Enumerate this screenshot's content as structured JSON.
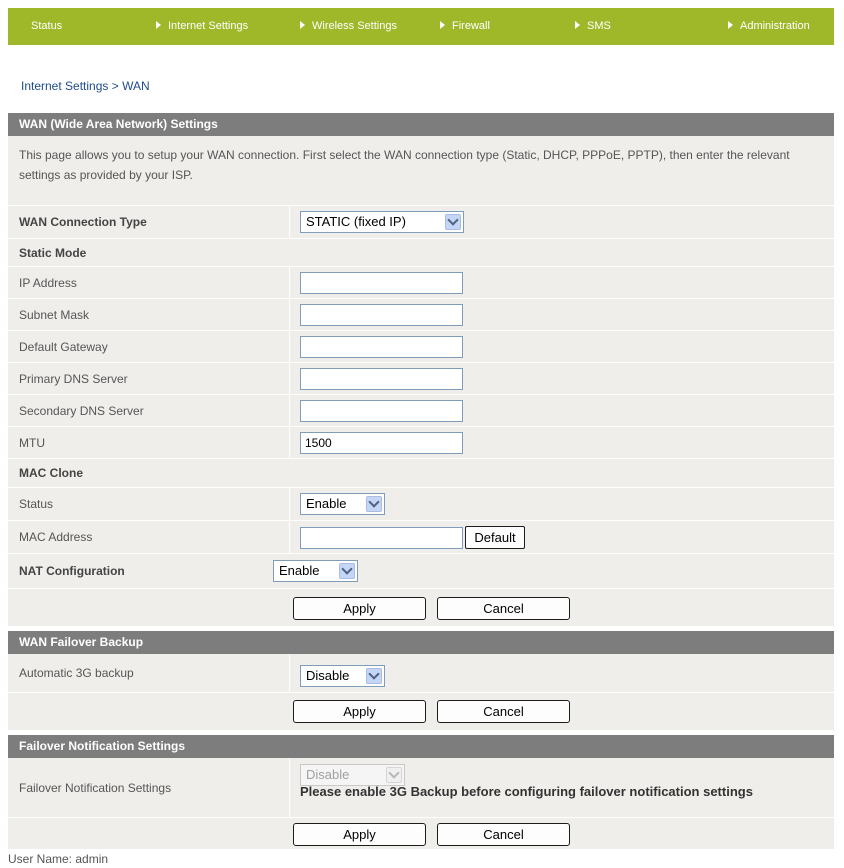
{
  "nav": {
    "items": [
      {
        "label": "Status",
        "arrow": false
      },
      {
        "label": "Internet Settings",
        "arrow": true
      },
      {
        "label": "Wireless Settings",
        "arrow": true
      },
      {
        "label": "Firewall",
        "arrow": true
      },
      {
        "label": "SMS",
        "arrow": true
      },
      {
        "label": "Administration",
        "arrow": true
      }
    ]
  },
  "breadcrumb": "Internet Settings > WAN",
  "wan": {
    "header": "WAN (Wide Area Network) Settings",
    "description": "This page allows you to setup your WAN connection. First select the WAN connection type (Static, DHCP, PPPoE, PPTP), then enter the relevant settings as provided by your ISP.",
    "connection_type_label": "WAN Connection Type",
    "connection_type_value": "STATIC (fixed IP)",
    "static_mode_label": "Static Mode",
    "ip_label": "IP Address",
    "ip_value": "",
    "subnet_label": "Subnet Mask",
    "subnet_value": "",
    "gateway_label": "Default Gateway",
    "gateway_value": "",
    "dns1_label": "Primary DNS Server",
    "dns1_value": "",
    "dns2_label": "Secondary DNS Server",
    "dns2_value": "",
    "mtu_label": "MTU",
    "mtu_value": "1500",
    "mac_clone_label": "MAC Clone",
    "status_label": "Status",
    "status_value": "Enable",
    "mac_label": "MAC Address",
    "mac_value": "",
    "default_button": "Default",
    "nat_label": "NAT Configuration",
    "nat_value": "Enable",
    "apply": "Apply",
    "cancel": "Cancel"
  },
  "failover": {
    "header": "WAN Failover Backup",
    "auto_label": "Automatic 3G backup",
    "auto_value": "Disable",
    "apply": "Apply",
    "cancel": "Cancel"
  },
  "notification": {
    "header": "Failover Notification Settings",
    "label": "Failover Notification Settings",
    "value": "Disable",
    "note": "Please enable 3G Backup before configuring failover notification settings",
    "apply": "Apply",
    "cancel": "Cancel"
  },
  "footer": {
    "user_label": "User Name:",
    "user_value": "admin"
  },
  "colors": {
    "nav_bg": "#9fb82a",
    "header_bg": "#7d7d7d",
    "row_bg": "#efeeeb",
    "link": "#1e4b8f"
  }
}
